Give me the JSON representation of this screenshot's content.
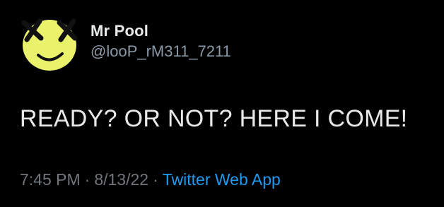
{
  "author": {
    "display_name": "Mr Pool",
    "handle": "@looP_rM311_7211",
    "avatar_icon": "yellow-smiley-x-eyes-icon"
  },
  "tweet": {
    "text": "READY? OR NOT? HERE I COME!",
    "time": "7:45 PM",
    "separator": "·",
    "date": "8/13/22",
    "source": "Twitter Web App"
  },
  "colors": {
    "background": "#000000",
    "text": "#e7e9ea",
    "muted": "#71767b",
    "link": "#1d9bf0",
    "avatar_yellow": "#e9f26a"
  }
}
